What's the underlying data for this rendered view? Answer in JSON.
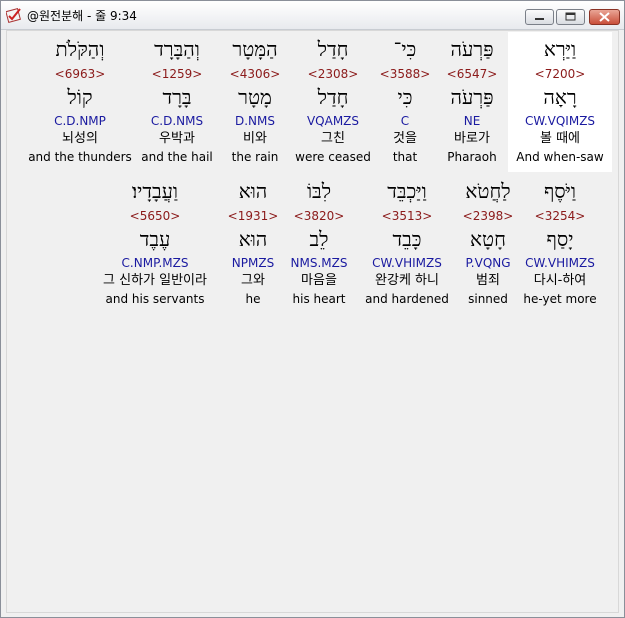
{
  "window": {
    "title": "@원전분해 - 줄 9:34",
    "icon": "bible-check-icon",
    "buttons": [
      "minimize",
      "maximize",
      "close"
    ]
  },
  "rows": [
    [
      {
        "hebrew": "וַיַּרְא",
        "strong": "<7200>",
        "lemma": "רָאָה",
        "morph": "CW.VQIMZS",
        "korean": "볼 때에",
        "english": "And when-saw",
        "selected": true
      },
      {
        "hebrew": "פַּרְעֹה",
        "strong": "<6547>",
        "lemma": "פַּרְעֹה",
        "morph": "NE",
        "korean": "바로가",
        "english": "Pharaoh"
      },
      {
        "hebrew": "כִּי־",
        "strong": "<3588>",
        "lemma": "כִּי",
        "morph": "C",
        "korean": "것을",
        "english": "that"
      },
      {
        "hebrew": "חָדַל",
        "strong": "<2308>",
        "lemma": "חָדַל",
        "morph": "VQAMZS",
        "korean": "그친",
        "english": "were ceased"
      },
      {
        "hebrew": "הַמָּטָר",
        "strong": "<4306>",
        "lemma": "מָטָר",
        "morph": "D.NMS",
        "korean": "비와",
        "english": "the rain"
      },
      {
        "hebrew": "וְהַבָּרָד",
        "strong": "<1259>",
        "lemma": "בָּרָד",
        "morph": "C.D.NMS",
        "korean": "우박과",
        "english": "and the hail"
      },
      {
        "hebrew": "וְהַקֹּלֹת",
        "strong": "<6963>",
        "lemma": "קוֹל",
        "morph": "C.D.NMP",
        "korean": "뇌성의",
        "english": "and the thunders"
      }
    ],
    [
      {
        "hebrew": "וַיֹּסֶף",
        "strong": "<3254>",
        "lemma": "יָסַף",
        "morph": "CW.VHIMZS",
        "korean": "다시-하여",
        "english": "he-yet more"
      },
      {
        "hebrew": "לַחֲטֹא",
        "strong": "<2398>",
        "lemma": "חָטָא",
        "morph": "P.VQNG",
        "korean": "범죄",
        "english": "sinned"
      },
      {
        "hebrew": "וַיַּכְבֵּד",
        "strong": "<3513>",
        "lemma": "כָּבֵד",
        "morph": "CW.VHIMZS",
        "korean": "완강케 하니",
        "english": "and hardened"
      },
      {
        "hebrew": "לִבּוֹ",
        "strong": "<3820>",
        "lemma": "לֵב",
        "morph": "NMS.MZS",
        "korean": "마음을",
        "english": "his heart"
      },
      {
        "hebrew": "הוּא",
        "strong": "<1931>",
        "lemma": "הוּא",
        "morph": "NPMZS",
        "korean": "그와",
        "english": "he"
      },
      {
        "hebrew": "וַעֲבָדָיו׃",
        "strong": "<5650>",
        "lemma": "עֶבֶד",
        "morph": "C.NMP.MZS",
        "korean": "그 신하가 일반이라",
        "english": "and his servants"
      }
    ]
  ],
  "colors": {
    "strong": "#8b1a1a",
    "morph": "#1a1aa0",
    "background": "#f0f0f0",
    "selected_background": "#ffffff"
  }
}
